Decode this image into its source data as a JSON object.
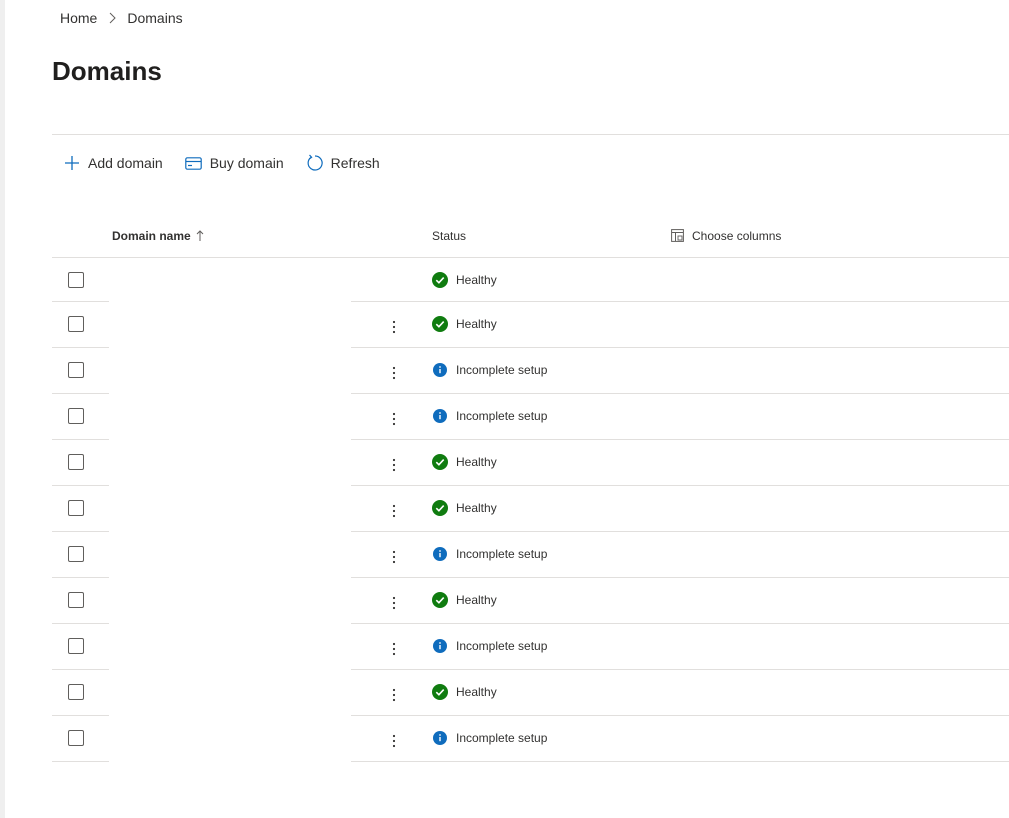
{
  "breadcrumb": {
    "home": "Home",
    "current": "Domains"
  },
  "page": {
    "title": "Domains"
  },
  "toolbar": {
    "add_domain": "Add domain",
    "buy_domain": "Buy domain",
    "refresh": "Refresh"
  },
  "table": {
    "columns": {
      "domain_name": "Domain name",
      "status": "Status",
      "choose_columns": "Choose columns"
    },
    "rows": [
      {
        "status": "Healthy",
        "icon": "check-circle-icon",
        "has_menu": false
      },
      {
        "status": "Healthy",
        "icon": "check-circle-icon",
        "has_menu": true
      },
      {
        "status": "Incomplete setup",
        "icon": "info-circle-icon",
        "has_menu": true
      },
      {
        "status": "Incomplete setup",
        "icon": "info-circle-icon",
        "has_menu": true
      },
      {
        "status": "Healthy",
        "icon": "check-circle-icon",
        "has_menu": true
      },
      {
        "status": "Healthy",
        "icon": "check-circle-icon",
        "has_menu": true
      },
      {
        "status": "Incomplete setup",
        "icon": "info-circle-icon",
        "has_menu": true
      },
      {
        "status": "Healthy",
        "icon": "check-circle-icon",
        "has_menu": true
      },
      {
        "status": "Incomplete setup",
        "icon": "info-circle-icon",
        "has_menu": true
      },
      {
        "status": "Healthy",
        "icon": "check-circle-icon",
        "has_menu": true
      },
      {
        "status": "Incomplete setup",
        "icon": "info-circle-icon",
        "has_menu": true
      }
    ]
  },
  "colors": {
    "healthy": "#107c10",
    "info": "#0f6cbd",
    "accent": "#0f6cbd",
    "divider": "#e1dfdd"
  }
}
